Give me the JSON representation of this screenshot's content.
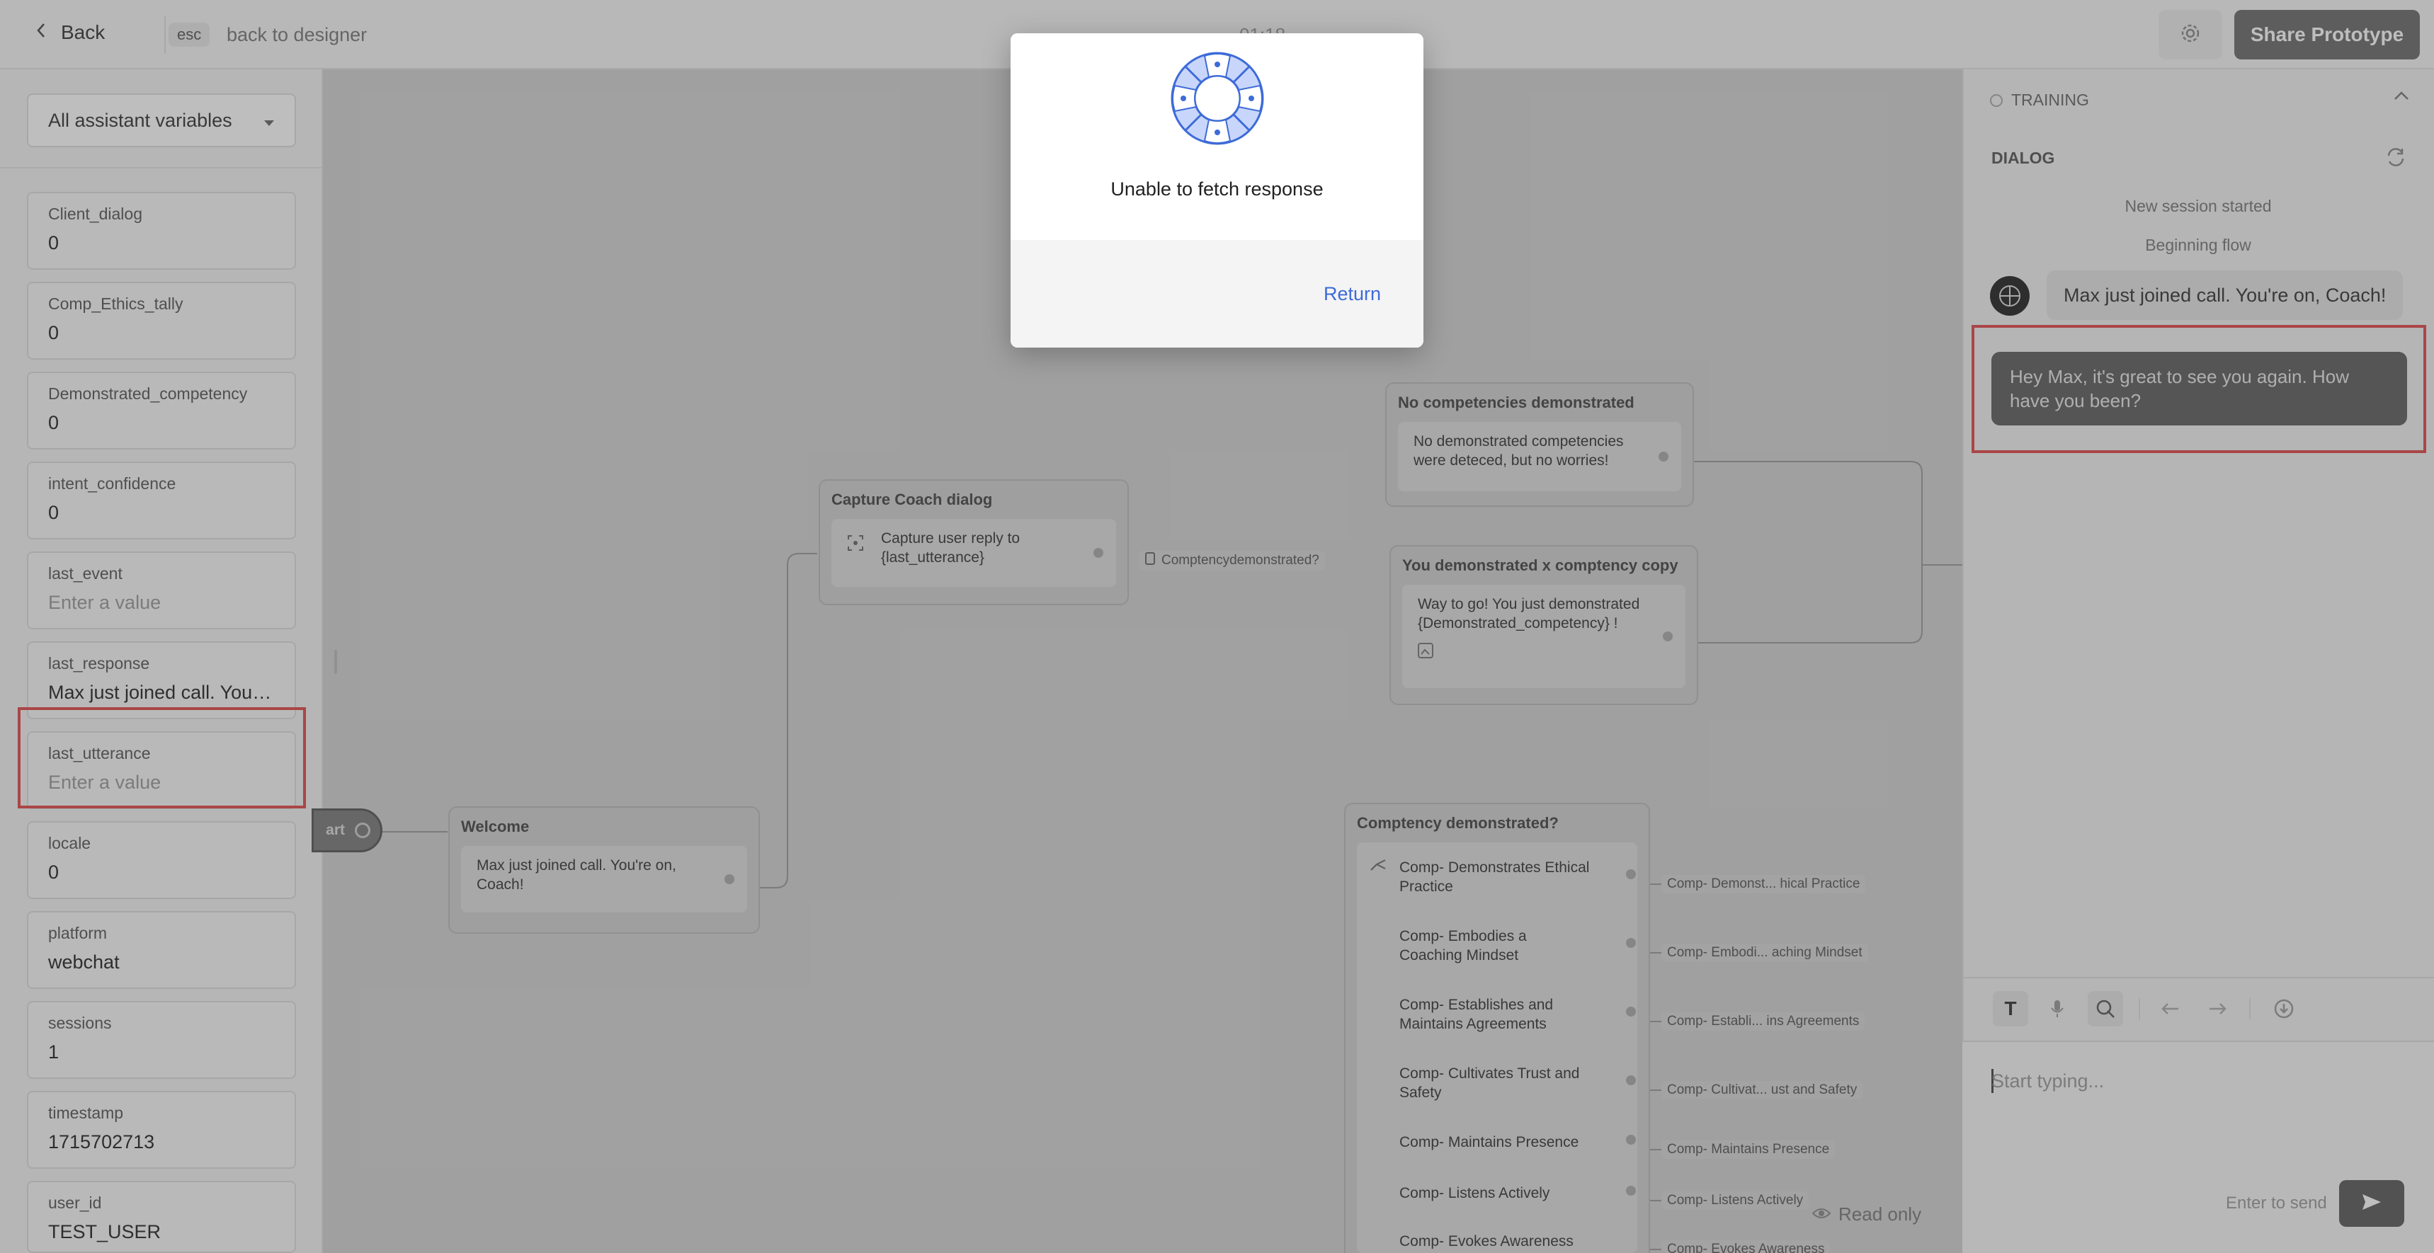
{
  "header": {
    "back_label": "Back",
    "esc_key": "esc",
    "back_to_designer": "back to designer",
    "timer": "01:18",
    "share_label": "Share Prototype"
  },
  "variables_panel": {
    "filter_selected": "All assistant variables",
    "variables": [
      {
        "name": "Client_dialog",
        "value": "0"
      },
      {
        "name": "Comp_Ethics_tally",
        "value": "0"
      },
      {
        "name": "Demonstrated_competency",
        "value": "0"
      },
      {
        "name": "intent_confidence",
        "value": "0"
      },
      {
        "name": "last_event",
        "placeholder": "Enter a value"
      },
      {
        "name": "last_response",
        "value": "Max just joined call. You'r..."
      },
      {
        "name": "last_utterance",
        "placeholder": "Enter a value"
      },
      {
        "name": "locale",
        "value": "0"
      },
      {
        "name": "platform",
        "value": "webchat"
      },
      {
        "name": "sessions",
        "value": "1"
      },
      {
        "name": "timestamp",
        "value": "1715702713"
      },
      {
        "name": "user_id",
        "value": "TEST_USER"
      }
    ]
  },
  "canvas": {
    "start_label": "art",
    "welcome": {
      "title": "Welcome",
      "text": "Max just joined call. You're on, Coach!"
    },
    "capture": {
      "title": "Capture Coach dialog",
      "text": "Capture user reply to {last_utterance}",
      "edge_label": "Comptencydemonstrated?"
    },
    "no_comp": {
      "title": "No competencies demonstrated",
      "text": "No demonstrated competencies were deteced, but no worries!"
    },
    "you_demo": {
      "title": "You demonstrated x comptency copy",
      "text": "Way to go! You just demonstrated {Demonstrated_competency} !"
    },
    "comp_block": {
      "title": "Comptency demonstrated?",
      "items": [
        {
          "label": "Comp- Demonstrates Ethical Practice",
          "edge": "Comp- Demonst... hical Practice"
        },
        {
          "label": "Comp- Embodies a Coaching Mindset",
          "edge": "Comp- Embodi... aching Mindset"
        },
        {
          "label": "Comp- Establishes and Maintains Agreements",
          "edge": "Comp- Establi... ins Agreements"
        },
        {
          "label": "Comp- Cultivates Trust and Safety",
          "edge": "Comp- Cultivat... ust and Safety"
        },
        {
          "label": "Comp- Maintains Presence",
          "edge": "Comp- Maintains Presence"
        },
        {
          "label": "Comp- Listens Actively",
          "edge": "Comp- Listens Actively"
        },
        {
          "label": "Comp- Evokes Awareness",
          "edge": "Comp- Evokes Awareness"
        }
      ]
    },
    "read_only": "Read only"
  },
  "test_panel": {
    "section_label": "TRAINING",
    "dialog_label": "DIALOG",
    "session_started": "New session started",
    "beginning_flow": "Beginning flow",
    "user_message": "Max just joined call. You're on, Coach!",
    "assistant_message": "Hey Max, it's great to see you again. How have you been?",
    "input_placeholder": "Start typing...",
    "enter_to_send": "Enter to send"
  },
  "modal": {
    "message": "Unable to fetch response",
    "return_label": "Return"
  }
}
